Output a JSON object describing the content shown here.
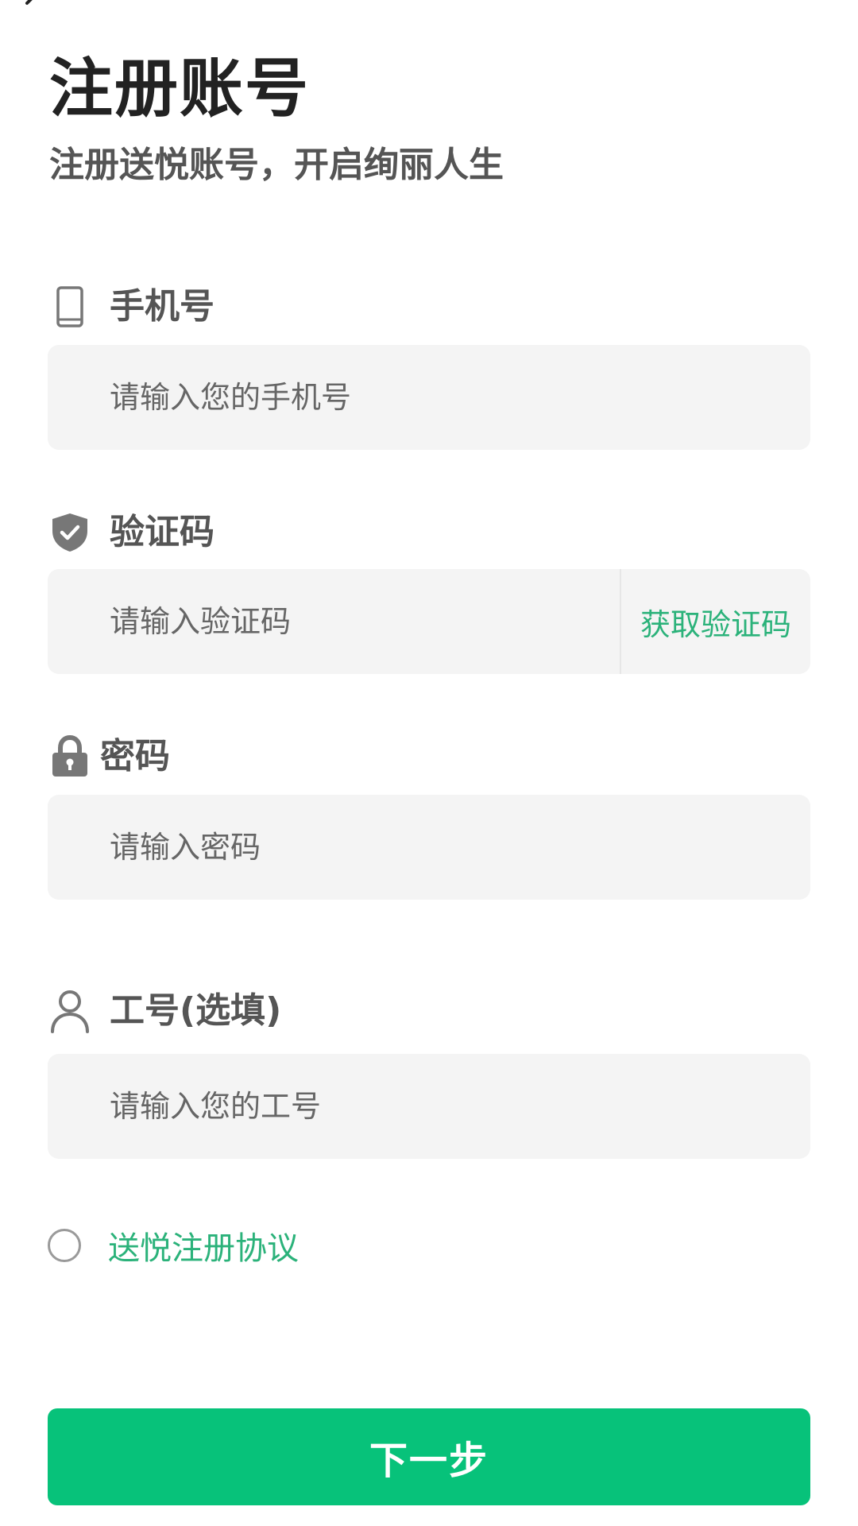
{
  "header": {
    "title": "注册账号",
    "subtitle": "注册送悦账号，开启绚丽人生"
  },
  "fields": {
    "phone": {
      "label": "手机号",
      "icon": "phone-icon",
      "placeholder": "请输入您的手机号"
    },
    "code": {
      "label": "验证码",
      "icon": "shield-check-icon",
      "placeholder": "请输入验证码",
      "get_code_label": "获取验证码"
    },
    "password": {
      "label": "密码",
      "icon": "lock-icon",
      "placeholder": "请输入密码"
    },
    "employee_id": {
      "label": "工号(选填)",
      "icon": "user-icon",
      "placeholder": "请输入您的工号"
    }
  },
  "agreement": {
    "label": "送悦注册协议",
    "checked": false
  },
  "next_button": {
    "label": "下一步"
  },
  "colors": {
    "accent": "#07c27a",
    "link": "#2bb27a",
    "input_bg": "#f4f4f4"
  }
}
